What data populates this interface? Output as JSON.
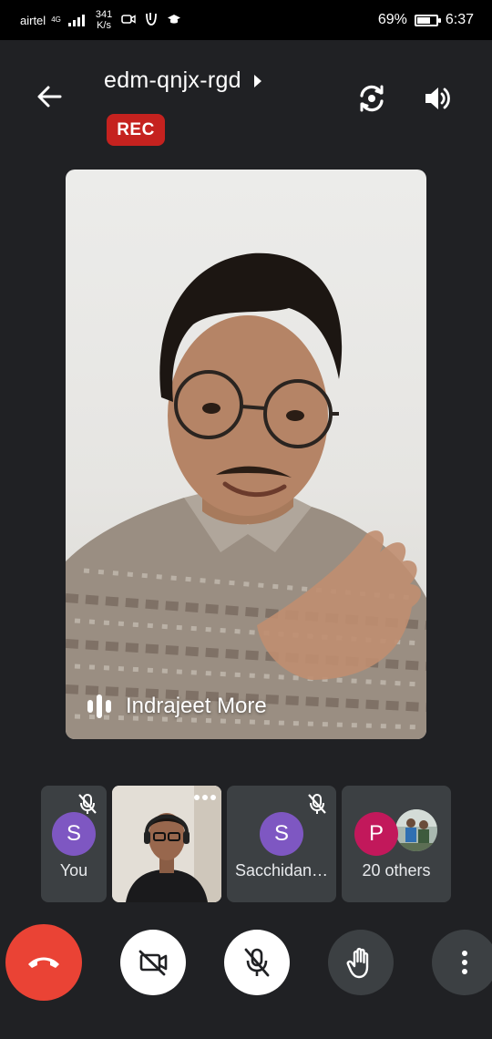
{
  "status_bar": {
    "carrier": "airtel",
    "network": "4G",
    "speed_value": "341",
    "speed_unit": "K/s",
    "battery_percent": "69%",
    "battery_level": 0.69,
    "time": "6:37"
  },
  "header": {
    "meeting_code": "edm-qnjx-rgd",
    "rec_label": "REC"
  },
  "main_video": {
    "speaker_name": "Indrajeet More"
  },
  "participants": [
    {
      "name": "You",
      "initial": "S",
      "avatar_color": "#7e57c2",
      "muted": true
    },
    {
      "name": "",
      "type": "video",
      "muted": false
    },
    {
      "name": "Sacchidan…",
      "initial": "S",
      "avatar_color": "#7e57c2",
      "muted": true
    },
    {
      "name": "20 others",
      "initial": "P",
      "avatar_color": "#c2185b"
    }
  ],
  "controls": {
    "end_call": "end-call-icon",
    "camera": "camera-off-icon",
    "microphone": "mic-off-icon",
    "raise_hand": "hand-icon",
    "more": "more-vert-icon"
  },
  "colors": {
    "background": "#202124",
    "rec_red": "#c5221f",
    "end_call_red": "#ea4335",
    "tile_grey": "#3c4043"
  }
}
